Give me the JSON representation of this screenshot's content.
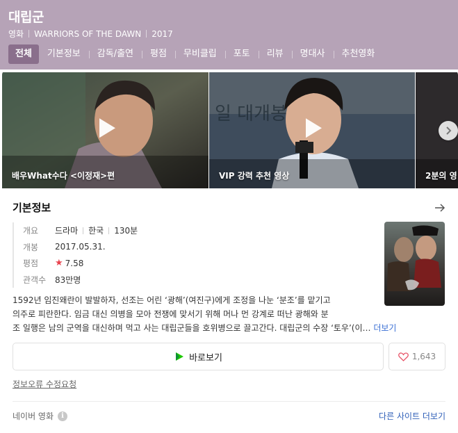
{
  "header": {
    "title": "대립군",
    "meta": [
      "영화",
      "WARRIORS OF THE DAWN",
      "2017"
    ],
    "tabs": [
      {
        "label": "전체",
        "active": true
      },
      {
        "label": "기본정보"
      },
      {
        "label": "감독/출연"
      },
      {
        "label": "평점"
      },
      {
        "label": "무비클립"
      },
      {
        "label": "포토"
      },
      {
        "label": "리뷰"
      },
      {
        "label": "명대사"
      },
      {
        "label": "추천영화"
      }
    ]
  },
  "videos": [
    {
      "caption": "배우What수다 <이정재>편"
    },
    {
      "caption": "VIP 강력 추천 영상"
    },
    {
      "caption": "2분의 영"
    }
  ],
  "basic_info": {
    "title": "기본정보",
    "overview_label": "개요",
    "overview": [
      "드라마",
      "한국",
      "130분"
    ],
    "release_label": "개봉",
    "release": "2017.05.31.",
    "rating_label": "평점",
    "rating": "7.58",
    "audience_label": "관객수",
    "audience": "83만명",
    "synopsis_line1": "1592년 임진왜란이 발발하자, 선조는 어린 ‘광해’(여진구)에게 조정을 나눈 ‘분조’를 맡기고",
    "synopsis_line2": "의주로 피란한다. 임금 대신 의병을 모아 전쟁에 맞서기 위해 머나 먼 강계로 떠난 광해와 분",
    "synopsis_line3": "조 일행은 남의 군역을 대신하며 먹고 사는 대립군들을 호위병으로 끌고간다. 대립군의 수장 ‘토우’(이…",
    "more_label": "더보기"
  },
  "actions": {
    "watch_label": "바로보기",
    "like_count": "1,643"
  },
  "report_label": "정보오류 수정요청",
  "footer": {
    "source": "네이버 영화",
    "other_sites": "다른 사이트 더보기"
  },
  "colors": {
    "header_bg": "#b6a3b7",
    "active_tab": "#8a6f8c",
    "star": "#e8424d",
    "link": "#3a6fd4",
    "play_green": "#1ec800"
  }
}
